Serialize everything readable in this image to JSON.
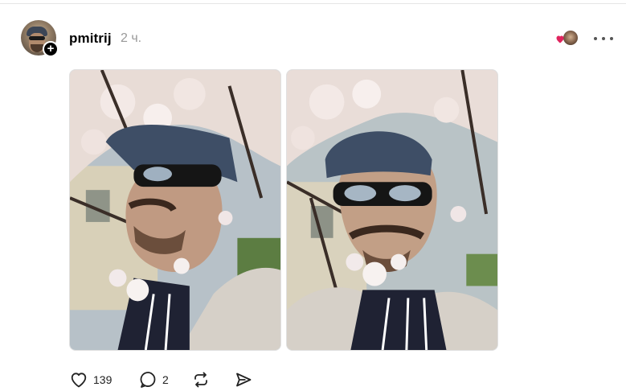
{
  "post": {
    "username": "pmitrij",
    "time": "2 ч.",
    "likes": "139",
    "replies": "2"
  },
  "icons": {
    "like": "heart-outline-icon",
    "reply": "speech-bubble-icon",
    "repost": "repost-arrows-icon",
    "share": "send-arrow-icon",
    "more": "more-dots-icon",
    "follow": "plus-icon",
    "liked": "red-heart-icon"
  },
  "colors": {
    "heart": "#e0245e",
    "timestamp": "#999999"
  }
}
